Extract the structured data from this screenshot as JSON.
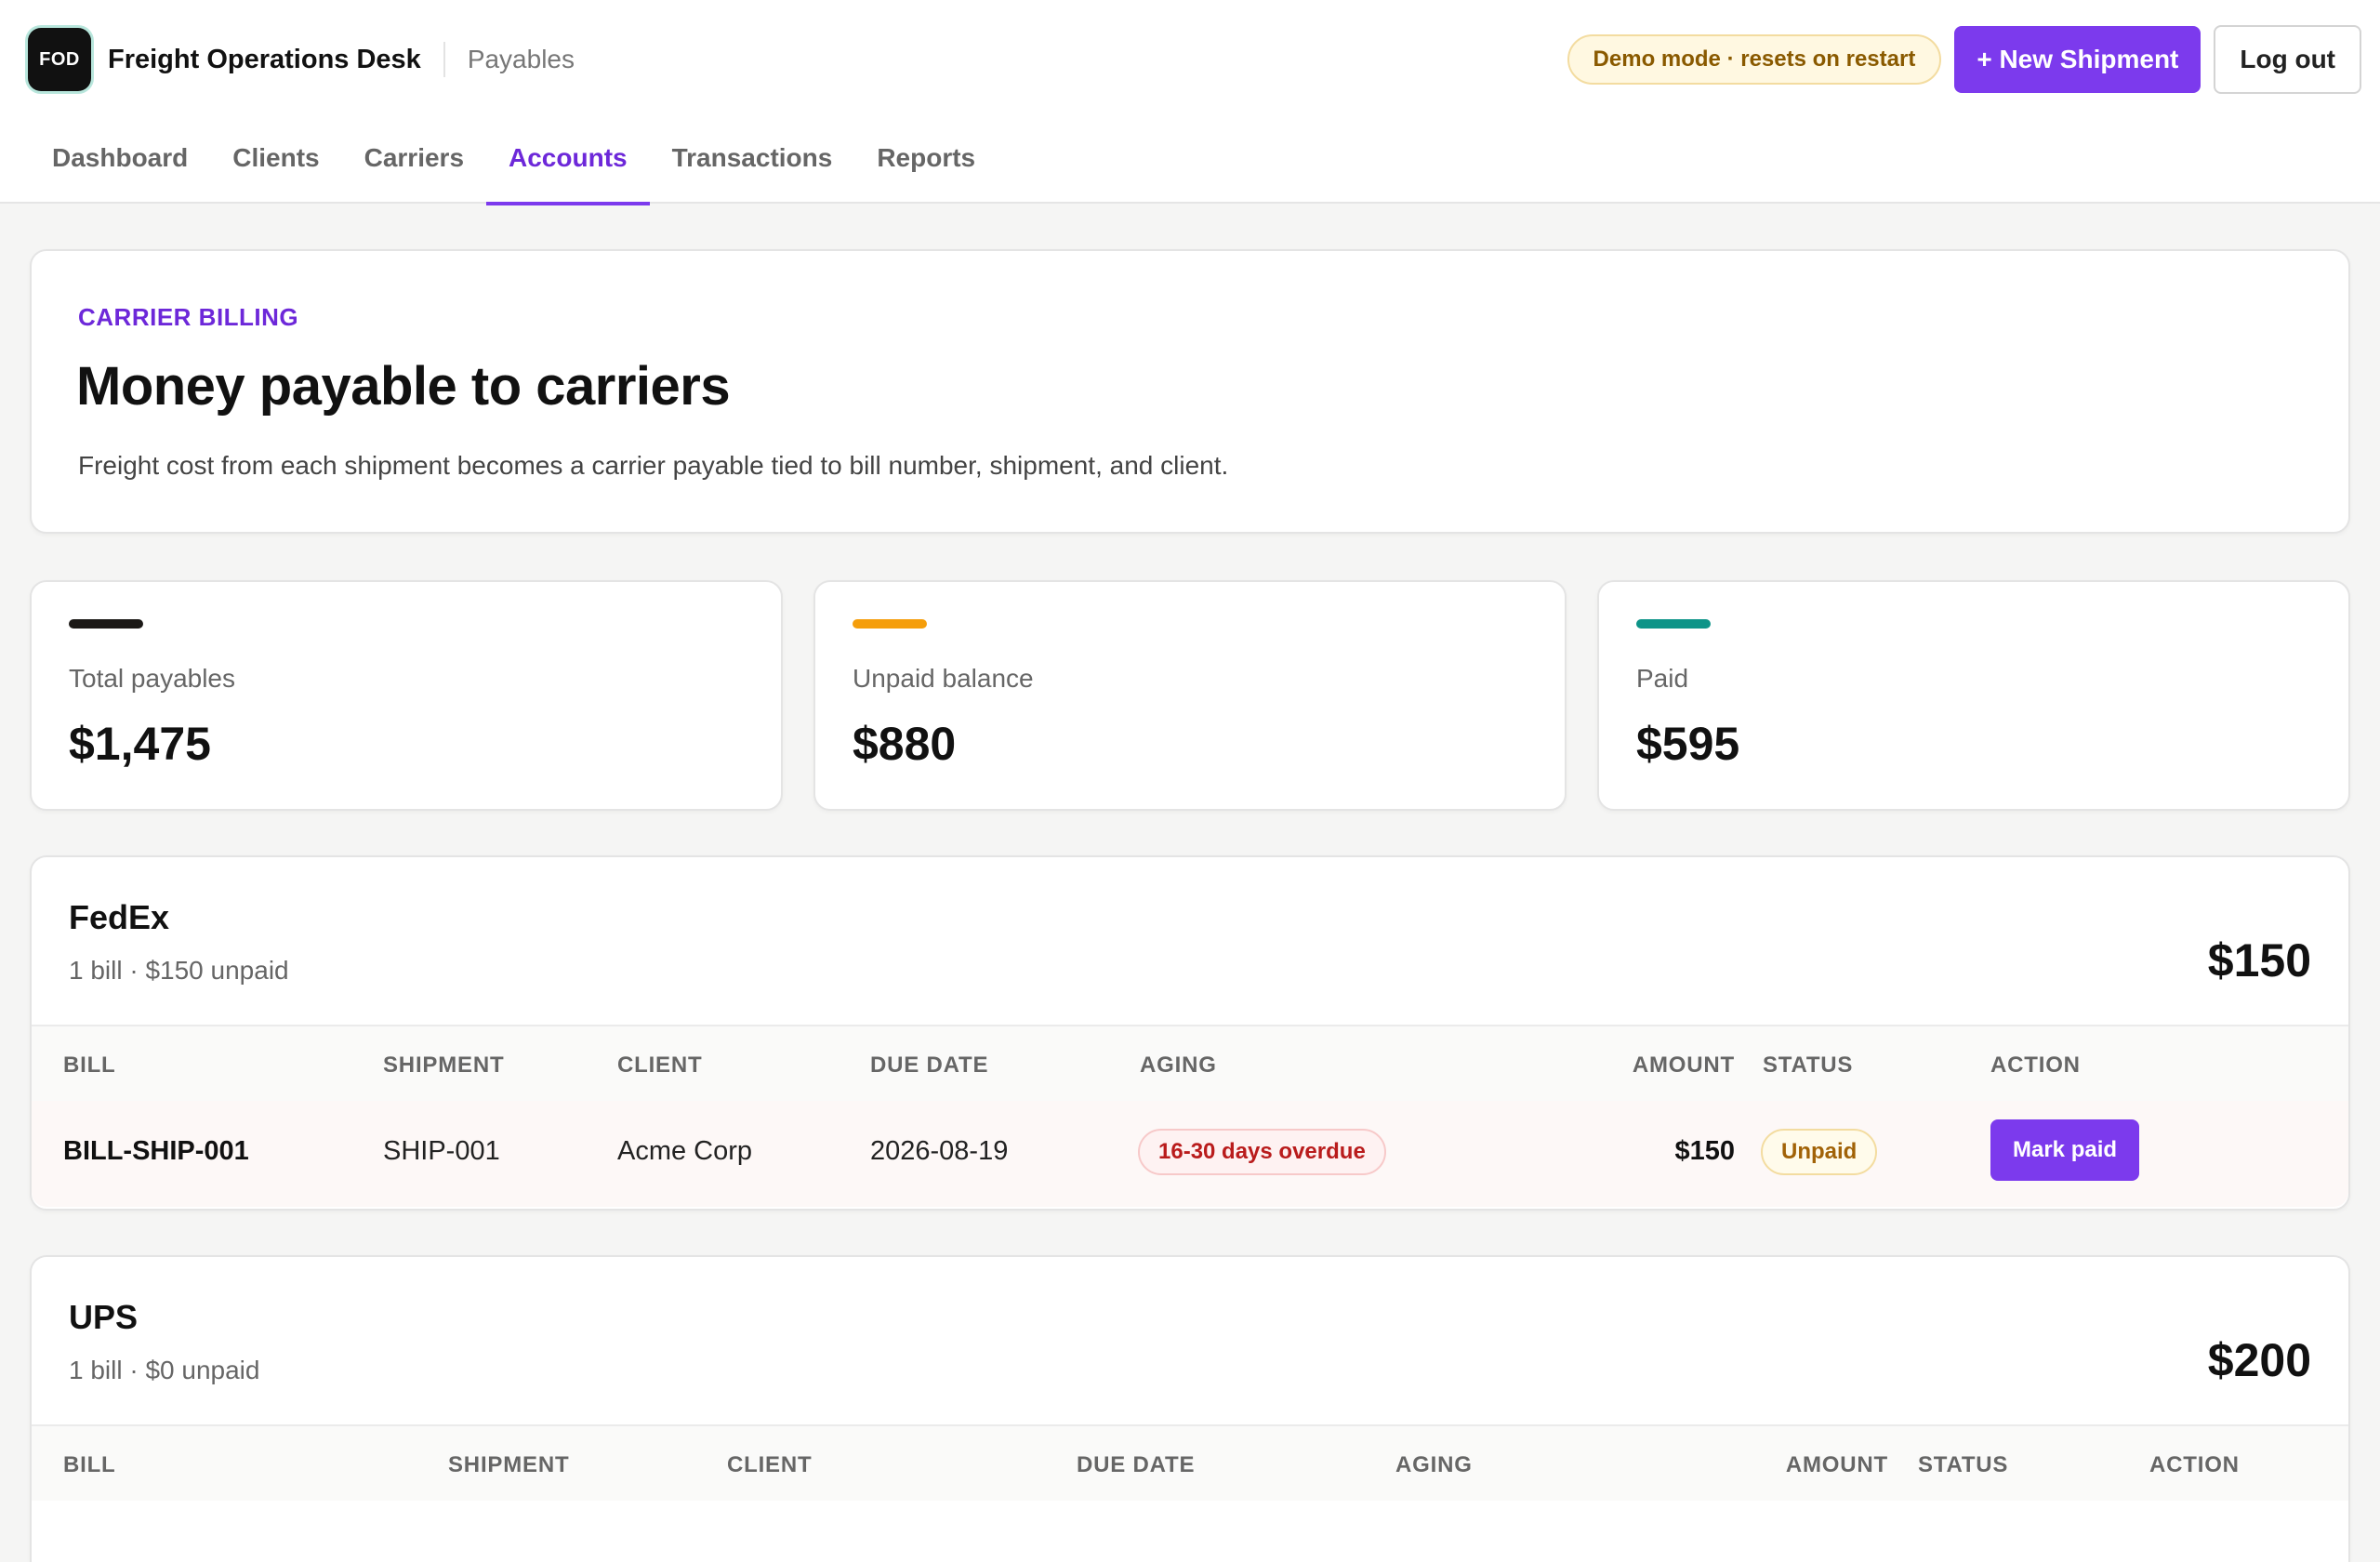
{
  "header": {
    "logo_text": "FOD",
    "app_title": "Freight Operations Desk",
    "section": "Payables",
    "demo_badge": "Demo mode · resets on restart",
    "new_shipment_label": "+ New Shipment",
    "logout_label": "Log out"
  },
  "nav": {
    "items": [
      {
        "label": "Dashboard",
        "active": false
      },
      {
        "label": "Clients",
        "active": false
      },
      {
        "label": "Carriers",
        "active": false
      },
      {
        "label": "Accounts",
        "active": true
      },
      {
        "label": "Transactions",
        "active": false
      },
      {
        "label": "Reports",
        "active": false
      }
    ]
  },
  "hero": {
    "eyebrow": "CARRIER BILLING",
    "title": "Money payable to carriers",
    "description": "Freight cost from each shipment becomes a carrier payable tied to bill number, shipment, and client."
  },
  "stats": [
    {
      "label": "Total payables",
      "value": "$1,475",
      "color": "#1c1917"
    },
    {
      "label": "Unpaid balance",
      "value": "$880",
      "color": "#f59e0b"
    },
    {
      "label": "Paid",
      "value": "$595",
      "color": "#0d9488"
    }
  ],
  "carriers": [
    {
      "name": "FedEx",
      "summary": "1 bill · $150 unpaid",
      "total": "$150",
      "columns": [
        "BILL",
        "SHIPMENT",
        "CLIENT",
        "DUE DATE",
        "AGING",
        "AMOUNT",
        "STATUS",
        "ACTION"
      ],
      "rows": [
        {
          "bill": "BILL-SHIP-001",
          "shipment": "SHIP-001",
          "client": "Acme Corp",
          "due_date": "2026-08-19",
          "aging": "16-30 days overdue",
          "amount": "$150",
          "status": "Unpaid",
          "action": "Mark paid"
        }
      ]
    },
    {
      "name": "UPS",
      "summary": "1 bill · $0 unpaid",
      "total": "$200",
      "columns": [
        "BILL",
        "SHIPMENT",
        "CLIENT",
        "DUE DATE",
        "AGING",
        "AMOUNT",
        "STATUS",
        "ACTION"
      ],
      "rows": []
    }
  ],
  "colors": {
    "accent": "#7c3aed",
    "accent_text": "#6d28d9",
    "background": "#f5f5f4"
  }
}
